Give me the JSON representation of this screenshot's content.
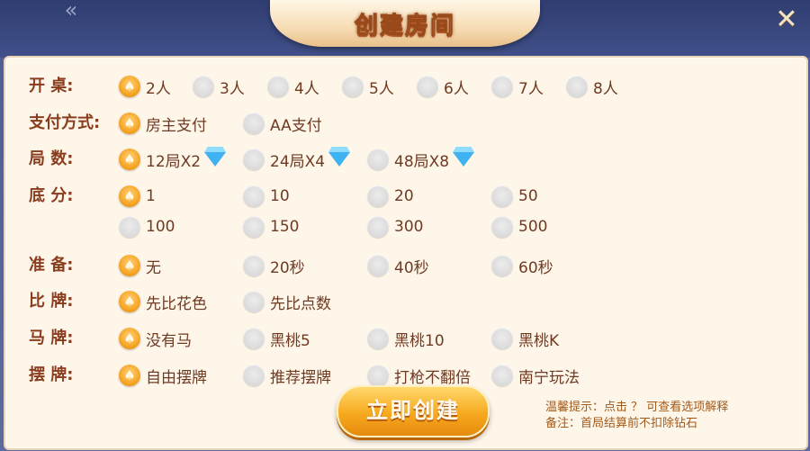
{
  "header": {
    "title": "创建房间",
    "back_glyph": "«",
    "close_glyph": "✕"
  },
  "rows": [
    {
      "label": "开    桌:",
      "options": [
        {
          "text": "2人",
          "selected": true
        },
        {
          "text": "3人",
          "selected": false
        },
        {
          "text": "4人",
          "selected": false
        },
        {
          "text": "5人",
          "selected": false
        },
        {
          "text": "6人",
          "selected": false
        },
        {
          "text": "7人",
          "selected": false
        },
        {
          "text": "8人",
          "selected": false
        }
      ]
    },
    {
      "label": "支付方式:",
      "options": [
        {
          "text": "房主支付",
          "selected": true
        },
        {
          "text": "AA支付",
          "selected": false
        }
      ]
    },
    {
      "label": "局    数:",
      "options": [
        {
          "text": "12局X2",
          "selected": true,
          "icon": "diamond-icon"
        },
        {
          "text": "24局X4",
          "selected": false,
          "icon": "diamond-icon"
        },
        {
          "text": "48局X8",
          "selected": false,
          "icon": "diamond-icon"
        }
      ]
    },
    {
      "label": "底    分:",
      "options": [
        {
          "text": "1",
          "selected": true
        },
        {
          "text": "10",
          "selected": false
        },
        {
          "text": "20",
          "selected": false
        },
        {
          "text": "50",
          "selected": false
        }
      ]
    },
    {
      "label": "",
      "options": [
        {
          "text": "100",
          "selected": false
        },
        {
          "text": "150",
          "selected": false
        },
        {
          "text": "300",
          "selected": false
        },
        {
          "text": "500",
          "selected": false
        }
      ]
    },
    {
      "label": "准    备:",
      "options": [
        {
          "text": "无",
          "selected": true
        },
        {
          "text": "20秒",
          "selected": false
        },
        {
          "text": "40秒",
          "selected": false
        },
        {
          "text": "60秒",
          "selected": false
        }
      ]
    },
    {
      "label": "比    牌:",
      "options": [
        {
          "text": "先比花色",
          "selected": true
        },
        {
          "text": "先比点数",
          "selected": false
        }
      ]
    },
    {
      "label": "马    牌:",
      "options": [
        {
          "text": "没有马",
          "selected": true
        },
        {
          "text": "黑桃5",
          "selected": false
        },
        {
          "text": "黑桃10",
          "selected": false
        },
        {
          "text": "黑桃K",
          "selected": false
        }
      ]
    },
    {
      "label": "摆    牌:",
      "options": [
        {
          "text": "自由摆牌",
          "selected": true
        },
        {
          "text": "推荐摆牌",
          "selected": false
        },
        {
          "text": "打枪不翻倍",
          "selected": false
        },
        {
          "text": "南宁玩法",
          "selected": false
        }
      ]
    }
  ],
  "create_button": "立即创建",
  "tips": {
    "line1": "温馨提示：点击 ？ 可查看选项解释",
    "line2": "备注：首局结算前不扣除钻石"
  },
  "colors": {
    "accent": "#f5a21f",
    "label": "#8a3d1e",
    "panel": "#fff6ea"
  }
}
